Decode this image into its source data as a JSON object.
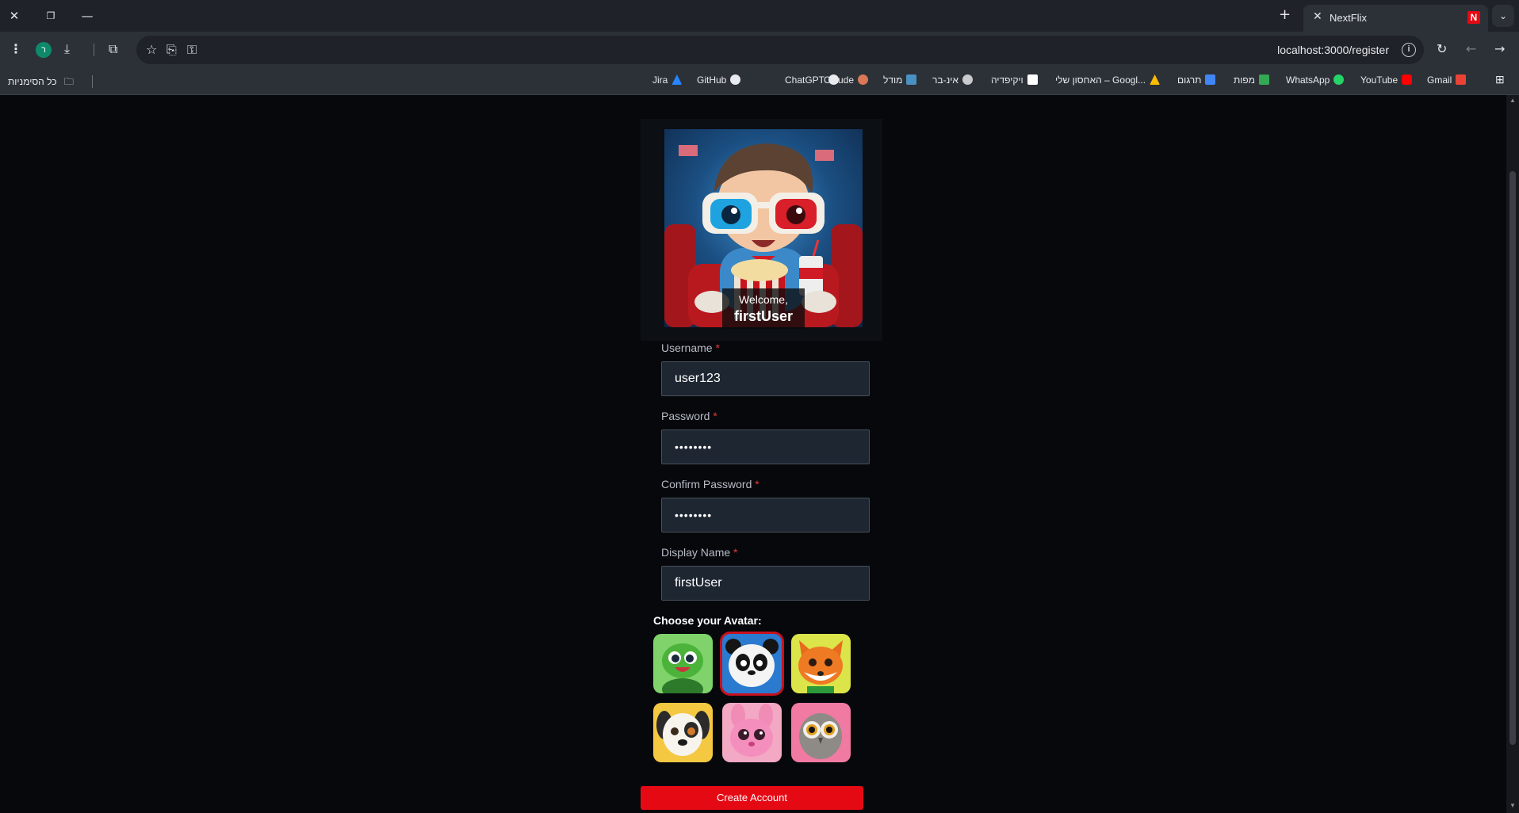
{
  "browser": {
    "tab_title": "NextFlix",
    "tab_favicon": "N",
    "url": "localhost:3000/register",
    "profile_initial": "ר",
    "bookmarks": [
      {
        "label": "Gmail",
        "color": "#ea4335"
      },
      {
        "label": "YouTube",
        "color": "#ff0000"
      },
      {
        "label": "WhatsApp",
        "color": "#25d366"
      },
      {
        "label": "מפות",
        "color": "#34a853"
      },
      {
        "label": "תרגום",
        "color": "#4285f4"
      },
      {
        "label": "האחסון שלי – Googl...",
        "color": "#fbbc04"
      },
      {
        "label": "ויקיפדיה",
        "color": "#ffffff"
      },
      {
        "label": "אינ-בר",
        "color": "#c8cacd"
      },
      {
        "label": "מודל",
        "color": "#4a90c2"
      },
      {
        "label": "Claude",
        "color": "#d97757"
      },
      {
        "label": "ChatGPT",
        "color": "#e8eaed"
      },
      {
        "label": "GitHub",
        "color": "#e8eaed"
      },
      {
        "label": "Jira",
        "color": "#2684ff"
      }
    ],
    "all_bookmarks": "כל הסימניות"
  },
  "hero": {
    "welcome": "Welcome,",
    "name": "firstUser"
  },
  "form": {
    "username_label": "Username",
    "username_value": "user123",
    "password_label": "Password",
    "password_value": "••••••••",
    "confirm_label": "Confirm Password",
    "confirm_value": "••••••••",
    "display_label": "Display Name",
    "display_value": "firstUser",
    "required_mark": "*",
    "avatar_title": "Choose your Avatar:",
    "avatars": [
      "turtle",
      "panda",
      "fox",
      "dog",
      "pink-bunny",
      "owl"
    ],
    "selected_avatar": "panda",
    "submit": "Create Account"
  },
  "colors": {
    "brand": "#e50914",
    "input_bg": "#1e2632",
    "page_bg": "#06080c"
  }
}
